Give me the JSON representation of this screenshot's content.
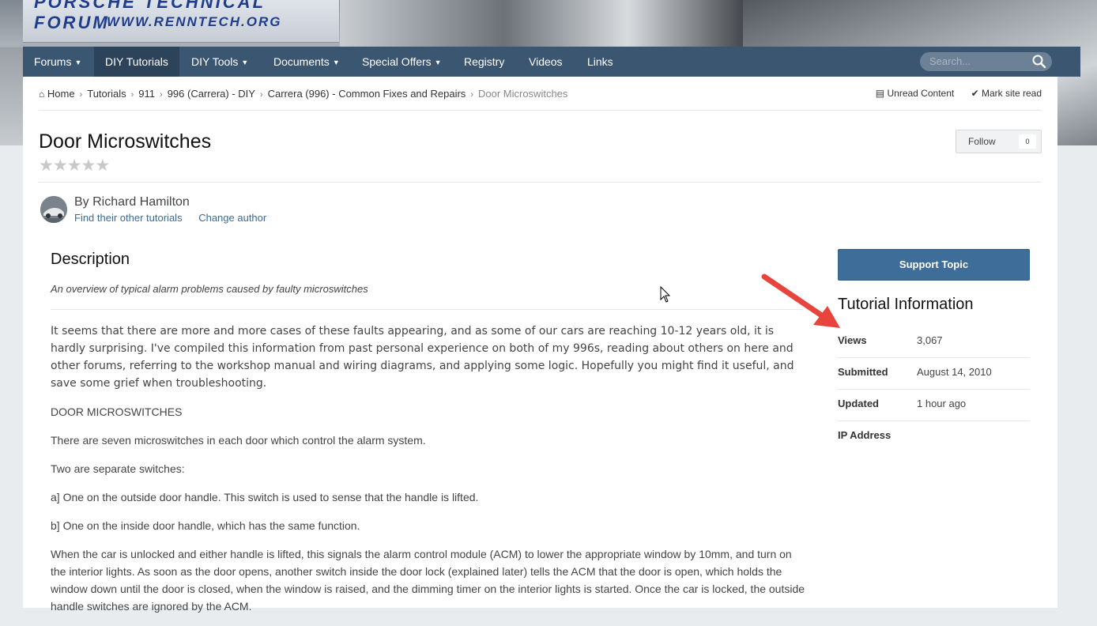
{
  "header": {
    "logo_line1": "PORSCHE TECHNICAL FORUM",
    "logo_line2": "WWW.RENNTECH.ORG"
  },
  "nav": {
    "items": [
      {
        "label": "Forums",
        "dropdown": true
      },
      {
        "label": "DIY Tutorials",
        "dropdown": false,
        "active": true
      },
      {
        "label": "DIY Tools",
        "dropdown": true
      },
      {
        "label": "Documents",
        "dropdown": true
      },
      {
        "label": "Special Offers",
        "dropdown": true
      },
      {
        "label": "Registry",
        "dropdown": false
      },
      {
        "label": "Videos",
        "dropdown": false
      },
      {
        "label": "Links",
        "dropdown": false
      }
    ],
    "search_placeholder": "Search..."
  },
  "breadcrumb": {
    "items": [
      "Home",
      "Tutorials",
      "911",
      "996 (Carrera) - DIY",
      "Carrera (996) - Common Fixes and Repairs"
    ],
    "current": "Door Microswitches"
  },
  "actions": {
    "unread": "Unread Content",
    "mark_read": "Mark site read"
  },
  "page": {
    "title": "Door Microswitches",
    "rating_stars": 5,
    "rating_value": 0,
    "follow_label": "Follow",
    "follow_count": "0"
  },
  "author": {
    "by": "By Richard Hamilton",
    "find_other": "Find their other tutorials",
    "change": "Change author"
  },
  "description": {
    "heading": "Description",
    "summary": "An overview of typical alarm problems caused by faulty microswitches"
  },
  "body": {
    "lead": "It seems that there are more and more cases of these faults appearing, and as some of our cars are reaching 10-12 years old, it is hardly surprising. I've compiled this information from past personal experience on both of my 996s, reading about others on here and other forums, referring to the workshop manual and wiring diagrams, and applying some logic. Hopefully you might find it useful, and save some grief when troubleshooting.",
    "p1": "DOOR MICROSWITCHES",
    "p2": "There are seven microswitches in each door which control the alarm system.",
    "p3": "Two are separate switches:",
    "p4": "a] One on the outside door handle. This switch is used to sense that the handle is lifted.",
    "p5": "b] One on the inside door handle, which has the same function.",
    "p6": "When the car is unlocked and either handle is lifted, this signals the alarm control module (ACM) to lower the appropriate window by 10mm, and turn on the interior lights. As soon as the door opens, another switch inside the door lock (explained later) tells the ACM that the door is open, which holds the window down until the door is closed, when the window is raised, and the dimming timer on the interior lights is started. Once the car is locked, the outside handle switches are ignored by the ACM."
  },
  "sidebar": {
    "support_button": "Support Topic",
    "info_heading": "Tutorial Information",
    "rows": [
      {
        "key": "Views",
        "value": "3,067"
      },
      {
        "key": "Submitted",
        "value": "August 14, 2010"
      },
      {
        "key": "Updated",
        "value": "1 hour ago"
      },
      {
        "key": "IP Address",
        "value": ""
      }
    ]
  },
  "colors": {
    "nav_bg": "#3a5670",
    "button": "#3e6d99",
    "link": "#3a6a96",
    "arrow": "#e8433c"
  }
}
